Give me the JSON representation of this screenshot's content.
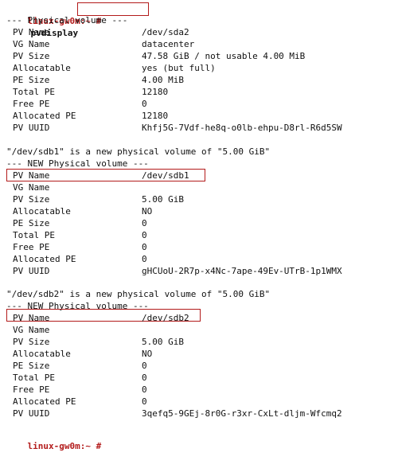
{
  "prompt": "linux-gw0m:~ #",
  "command": "pvdisplay",
  "pv1": {
    "header": "--- Physical volume ---",
    "rows": [
      {
        "k": "PV Name",
        "v": "/dev/sda2"
      },
      {
        "k": "VG Name",
        "v": "datacenter"
      },
      {
        "k": "PV Size",
        "v": "47.58 GiB / not usable 4.00 MiB"
      },
      {
        "k": "Allocatable",
        "v": "yes (but full)"
      },
      {
        "k": "PE Size",
        "v": "4.00 MiB"
      },
      {
        "k": "Total PE",
        "v": "12180"
      },
      {
        "k": "Free PE",
        "v": "0"
      },
      {
        "k": "Allocated PE",
        "v": "12180"
      },
      {
        "k": "PV UUID",
        "v": "Khfj5G-7Vdf-he8q-o0lb-ehpu-D8rl-R6d5SW"
      }
    ]
  },
  "pv2": {
    "intro": "\"/dev/sdb1\" is a new physical volume of \"5.00 GiB\"",
    "header": "--- NEW Physical volume ---",
    "rows": [
      {
        "k": "PV Name",
        "v": "/dev/sdb1"
      },
      {
        "k": "VG Name",
        "v": ""
      },
      {
        "k": "PV Size",
        "v": "5.00 GiB"
      },
      {
        "k": "Allocatable",
        "v": "NO"
      },
      {
        "k": "PE Size",
        "v": "0"
      },
      {
        "k": "Total PE",
        "v": "0"
      },
      {
        "k": "Free PE",
        "v": "0"
      },
      {
        "k": "Allocated PE",
        "v": "0"
      },
      {
        "k": "PV UUID",
        "v": "gHCUoU-2R7p-x4Nc-7ape-49Ev-UTrB-1p1WMX"
      }
    ]
  },
  "pv3": {
    "intro": "\"/dev/sdb2\" is a new physical volume of \"5.00 GiB\"",
    "header": "--- NEW Physical volume ---",
    "rows": [
      {
        "k": "PV Name",
        "v": "/dev/sdb2"
      },
      {
        "k": "VG Name",
        "v": ""
      },
      {
        "k": "PV Size",
        "v": "5.00 GiB"
      },
      {
        "k": "Allocatable",
        "v": "NO"
      },
      {
        "k": "PE Size",
        "v": "0"
      },
      {
        "k": "Total PE",
        "v": "0"
      },
      {
        "k": "Free PE",
        "v": "0"
      },
      {
        "k": "Allocated PE",
        "v": "0"
      },
      {
        "k": "PV UUID",
        "v": "3qefq5-9GEj-8r0G-r3xr-CxLt-dljm-Wfcmq2"
      }
    ]
  },
  "final_prompt": "linux-gw0m:~ #",
  "colors": {
    "highlight": "#b31b1b"
  }
}
